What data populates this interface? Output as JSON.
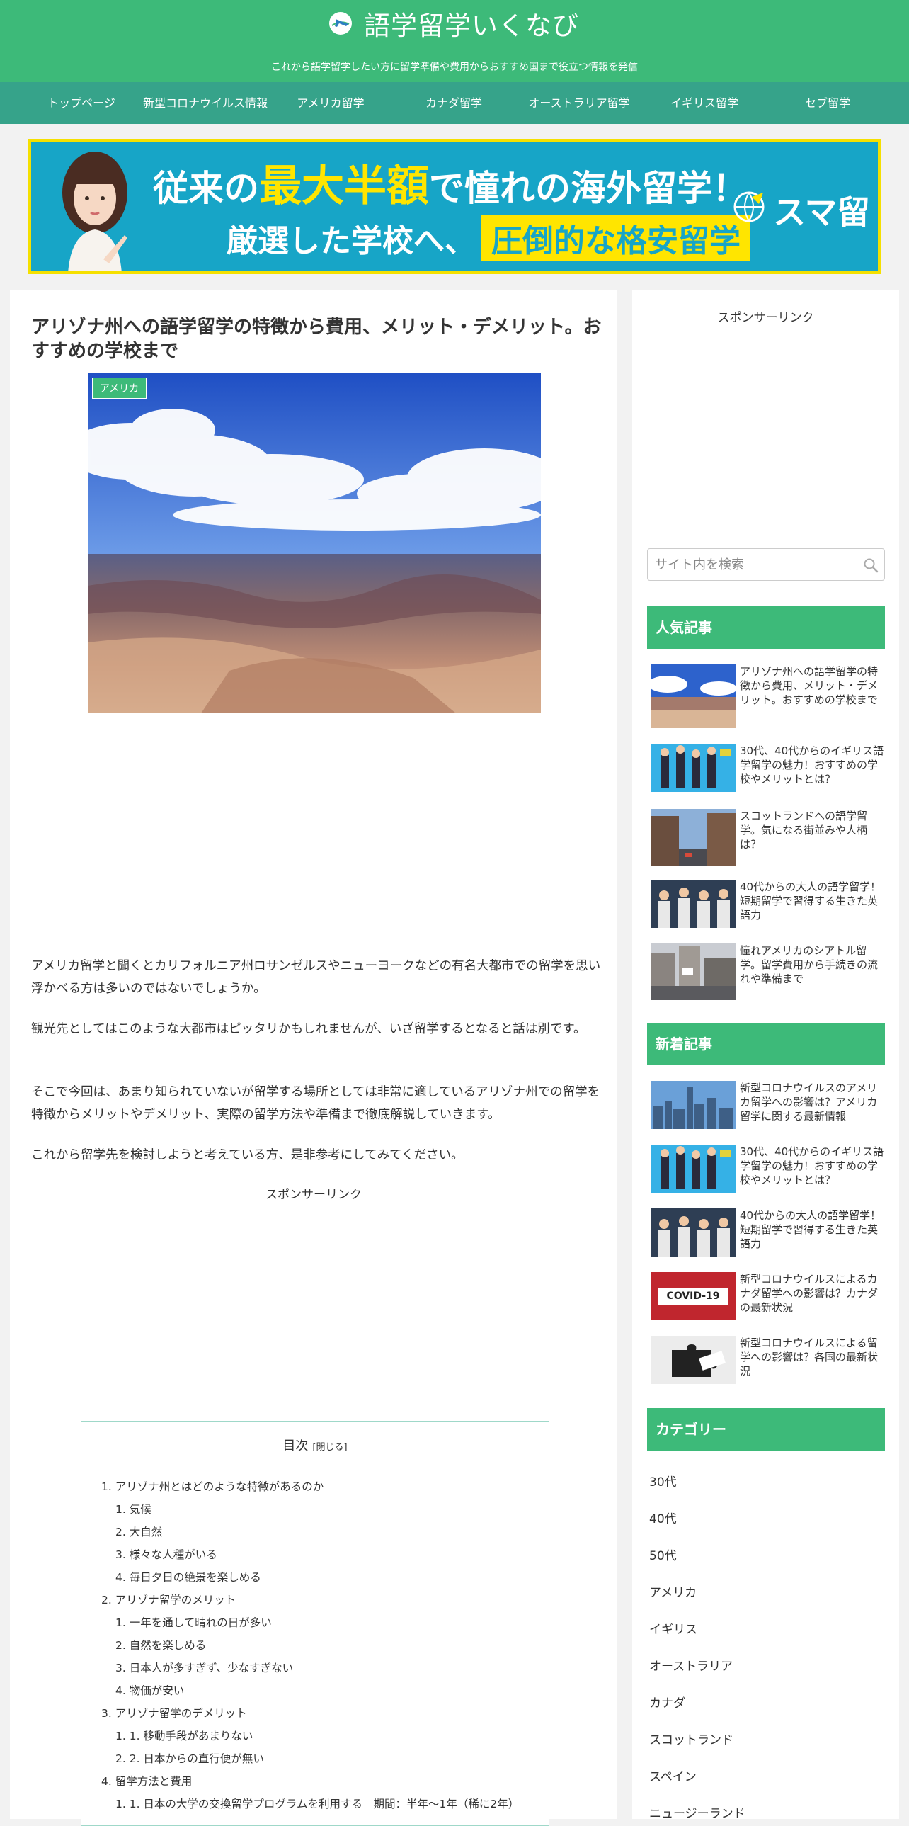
{
  "header": {
    "title": "語学留学いくなび",
    "tagline": "これから語学留学したい方に留学準備や費用からおすすめ国まで役立つ情報を発信"
  },
  "nav": [
    "トップページ",
    "新型コロナウイルス情報",
    "アメリカ留学",
    "カナダ留学",
    "オーストラリア留学",
    "イギリス留学",
    "セブ留学"
  ],
  "banner": {
    "line1_pre": "従来の",
    "line1_highlight": "最大半額",
    "line1_post": "で憧れの海外留学！",
    "line2_pre": "厳選した学校へ、",
    "line2_box": "圧倒的な格安留学",
    "logo": "スマ留"
  },
  "article": {
    "title": "アリゾナ州への語学留学の特徴から費用、メリット・デメリット。おすすめの学校まで",
    "category": "アメリカ",
    "paragraphs": [
      "アメリカ留学と聞くとカリフォルニア州ロサンゼルスやニューヨークなどの有名大都市での留学を思い浮かべる方は多いのではないでしょうか。",
      "観光先としてはこのような大都市はピッタリかもしれませんが、いざ留学するとなると話は別です。",
      "そこで今回は、あまり知られていないが留学する場所としては非常に適しているアリゾナ州での留学を特徴からメリットやデメリット、実際の留学方法や準備まで徹底解説していきます。",
      "これから留学先を検討しようと考えている方、是非参考にしてみてください。"
    ],
    "sponsor": "スポンサーリンク"
  },
  "toc": {
    "title": "目次",
    "close": "[閉じる]",
    "items": [
      {
        "text": "1. アリゾナ州とはどのような特徴があるのか",
        "level": 1
      },
      {
        "text": "1. 気候",
        "level": 2
      },
      {
        "text": "2. 大自然",
        "level": 2
      },
      {
        "text": "3. 様々な人種がいる",
        "level": 2
      },
      {
        "text": "4. 毎日夕日の絶景を楽しめる",
        "level": 2
      },
      {
        "text": "2. アリゾナ留学のメリット",
        "level": 1
      },
      {
        "text": "1. 一年を通して晴れの日が多い",
        "level": 2
      },
      {
        "text": "2. 自然を楽しめる",
        "level": 2
      },
      {
        "text": "3. 日本人が多すぎず、少なすぎない",
        "level": 2
      },
      {
        "text": "4. 物価が安い",
        "level": 2
      },
      {
        "text": "3. アリゾナ留学のデメリット",
        "level": 1
      },
      {
        "text": "1. 1. 移動手段があまりない",
        "level": 2
      },
      {
        "text": "2. 2. 日本からの直行便が無い",
        "level": 2
      },
      {
        "text": "4. 留学方法と費用",
        "level": 1
      },
      {
        "text": "1. 1. 日本の大学の交換留学プログラムを利用する　期間：半年～1年（稀に2年）",
        "level": 2
      }
    ]
  },
  "sidebar": {
    "sponsor": "スポンサーリンク",
    "search_placeholder": "サイト内を検索",
    "popular_title": "人気記事",
    "popular": [
      {
        "title": "アリゾナ州への語学留学の特徴から費用、メリット・デメリット。おすすめの学校まで",
        "thumb": "canyon"
      },
      {
        "title": "30代、40代からのイギリス語学留学の魅力！おすすめの学校やメリットとは？",
        "thumb": "people"
      },
      {
        "title": "スコットランドへの語学留学。気になる街並みや人柄は？",
        "thumb": "street"
      },
      {
        "title": "40代からの大人の語学留学！短期留学で習得する生きた英語力",
        "thumb": "group"
      },
      {
        "title": "憧れアメリカのシアトル留学。留学費用から手続きの流れや準備まで",
        "thumb": "city"
      }
    ],
    "new_title": "新着記事",
    "new": [
      {
        "title": "新型コロナウイルスのアメリカ留学への影響は？アメリカ留学に関する最新情報",
        "thumb": "skyline"
      },
      {
        "title": "30代、40代からのイギリス語学留学の魅力！おすすめの学校やメリットとは？",
        "thumb": "people"
      },
      {
        "title": "40代からの大人の語学留学！短期留学で習得する生きた英語力",
        "thumb": "group"
      },
      {
        "title": "新型コロナウイルスによるカナダ留学への影響は？カナダの最新状況",
        "thumb": "covid",
        "label": "COVID-19"
      },
      {
        "title": "新型コロナウイルスによる留学への影響は？各国の最新状況",
        "thumb": "puzzle"
      }
    ],
    "category_title": "カテゴリー",
    "categories": [
      "30代",
      "40代",
      "50代",
      "アメリカ",
      "イギリス",
      "オーストラリア",
      "カナダ",
      "スコットランド",
      "スペイン",
      "ニュージーランド"
    ]
  },
  "colors": {
    "brand": "#3dba79",
    "nav": "#36a38a",
    "banner_blue": "#17a5c7",
    "banner_yellow": "#ffe500"
  }
}
